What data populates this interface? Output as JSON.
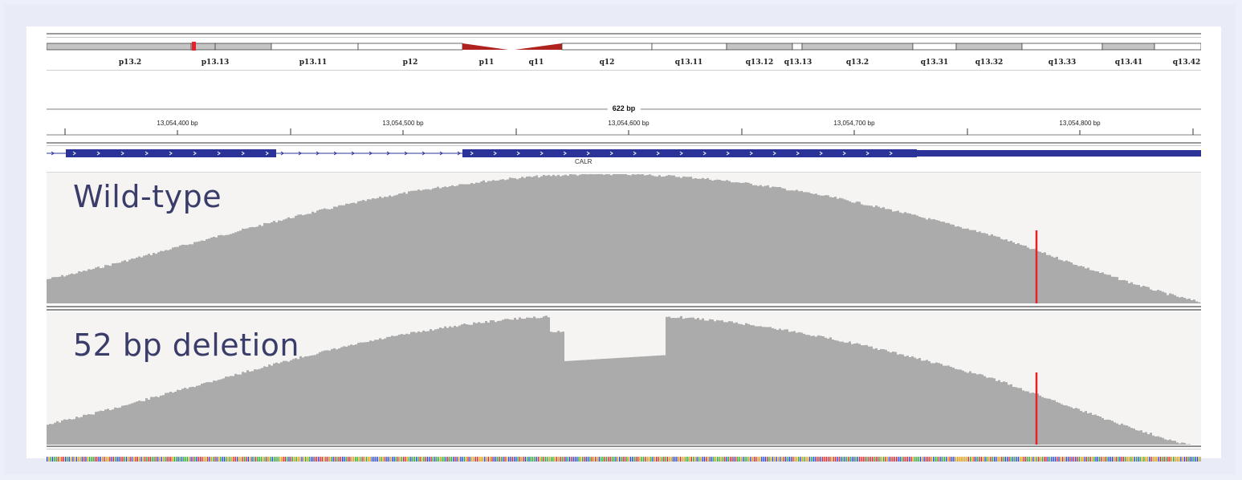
{
  "ideogram": {
    "bands": [
      "p13.2",
      "p13.13",
      "p13.11",
      "p12",
      "p11",
      "q11",
      "q12",
      "q13.11",
      "q13.12",
      "q13.13",
      "q13.2",
      "q13.31",
      "q13.32",
      "q13.33",
      "q13.41",
      "q13.42"
    ],
    "region_marker_color": "#e8202a",
    "centromere_color": "#b0221e"
  },
  "ruler": {
    "span_label": "622 bp",
    "ticks": [
      "13,054,400 bp",
      "13,054,500 bp",
      "13,054,600 bp",
      "13,054,700 bp",
      "13,054,800 bp"
    ]
  },
  "gene_track": {
    "gene_name": "CALR",
    "color": "#2b3399"
  },
  "tracks": [
    {
      "label": "Wild-type"
    },
    {
      "label": "52 bp deletion"
    }
  ],
  "colors": {
    "coverage_fill": "#ababab",
    "variant_line": "#e8202a",
    "label_text": "#3a3d6a",
    "seq_bases": [
      "#22aa22",
      "#1f3fd6",
      "#e29900",
      "#d91f1f"
    ]
  }
}
